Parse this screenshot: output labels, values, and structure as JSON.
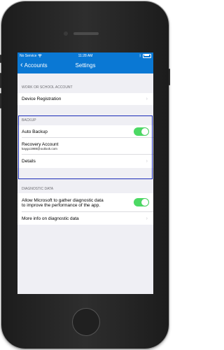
{
  "status": {
    "carrier": "No Service",
    "time": "11:28 AM"
  },
  "nav": {
    "back": "Accounts",
    "title": "Settings"
  },
  "sections": {
    "work": {
      "header": "WORK OR SCHOOL ACCOUNT",
      "items": [
        "Device Registration"
      ]
    },
    "backup": {
      "header": "BACKUP",
      "auto_backup": "Auto Backup",
      "auto_backup_on": true,
      "recovery_label": "Recovery Account",
      "recovery_email": "kaygo1988@outlook.com",
      "details": "Details"
    },
    "diagnostic": {
      "header": "DIAGNOSTIC DATA",
      "allow_line1": "Allow Microsoft to gather diagnostic data",
      "allow_line2": "to improve the performance of the app.",
      "allow_on": true,
      "more_info": "More info on diagnostic data"
    }
  },
  "colors": {
    "accent": "#0a78d4",
    "toggle_on": "#4cd964",
    "highlight": "#1a2bb7"
  }
}
